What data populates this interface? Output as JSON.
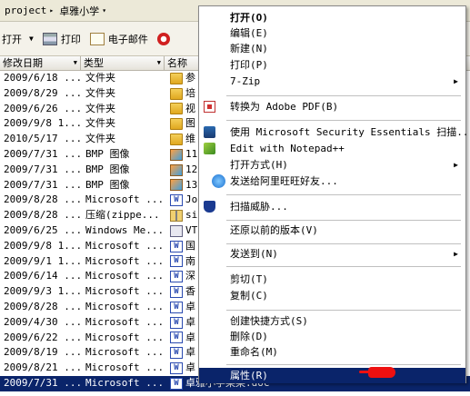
{
  "address": {
    "path": [
      "project",
      "卓雅小学"
    ]
  },
  "toolbar": {
    "open": "打开",
    "print": "打印",
    "email": "电子邮件"
  },
  "headers": {
    "date": "修改日期",
    "type": "类型",
    "name": "名称"
  },
  "rows": [
    {
      "date": "2009/6/18 ...",
      "type": "文件夹",
      "icon": "folder",
      "name": "参"
    },
    {
      "date": "2009/8/29 ...",
      "type": "文件夹",
      "icon": "folder",
      "name": "培"
    },
    {
      "date": "2009/6/26 ...",
      "type": "文件夹",
      "icon": "folder",
      "name": "视"
    },
    {
      "date": "2009/9/8 1...",
      "type": "文件夹",
      "icon": "folder",
      "name": "图"
    },
    {
      "date": "2010/5/17 ...",
      "type": "文件夹",
      "icon": "folder",
      "name": "维"
    },
    {
      "date": "2009/7/31 ...",
      "type": "BMP 图像",
      "icon": "bmp",
      "name": "11"
    },
    {
      "date": "2009/7/31 ...",
      "type": "BMP 图像",
      "icon": "bmp",
      "name": "12"
    },
    {
      "date": "2009/7/31 ...",
      "type": "BMP 图像",
      "icon": "bmp",
      "name": "13"
    },
    {
      "date": "2009/8/28 ...",
      "type": "Microsoft ...",
      "icon": "doc",
      "name": "Jo"
    },
    {
      "date": "2009/8/28 ...",
      "type": "压缩(zippe...",
      "icon": "zip",
      "name": "si"
    },
    {
      "date": "2009/6/25 ...",
      "type": "Windows Me...",
      "icon": "media",
      "name": "VT"
    },
    {
      "date": "2009/9/8 1...",
      "type": "Microsoft ...",
      "icon": "doc",
      "name": "国"
    },
    {
      "date": "2009/9/1 1...",
      "type": "Microsoft ...",
      "icon": "doc",
      "name": "南"
    },
    {
      "date": "2009/6/14 ...",
      "type": "Microsoft ...",
      "icon": "doc",
      "name": "深"
    },
    {
      "date": "2009/9/3 1...",
      "type": "Microsoft ...",
      "icon": "doc",
      "name": "香"
    },
    {
      "date": "2009/8/28 ...",
      "type": "Microsoft ...",
      "icon": "doc",
      "name": "卓"
    },
    {
      "date": "2009/4/30 ...",
      "type": "Microsoft ...",
      "icon": "doc",
      "name": "卓"
    },
    {
      "date": "2009/6/22 ...",
      "type": "Microsoft ...",
      "icon": "doc",
      "name": "卓"
    },
    {
      "date": "2009/8/19 ...",
      "type": "Microsoft ...",
      "icon": "doc",
      "name": "卓"
    },
    {
      "date": "2009/8/21 ...",
      "type": "Microsoft ...",
      "icon": "doc",
      "name": "卓"
    },
    {
      "date": "2009/7/31 ...",
      "type": "Microsoft ...",
      "icon": "doc",
      "name": "卓雅小学某某.doc",
      "selected": true
    }
  ],
  "menu": {
    "open": "打开(O)",
    "edit": "编辑(E)",
    "new": "新建(N)",
    "print": "打印(P)",
    "zip": "7-Zip",
    "pdf": "转换为 Adobe PDF(B)",
    "mse": "使用 Microsoft Security Essentials 扫描...",
    "notepad": "Edit with Notepad++",
    "openwith": "打开方式(H)",
    "wangwang": "发送给阿里旺旺好友...",
    "scan": "扫描威胁...",
    "restore": "还原以前的版本(V)",
    "sendto": "发送到(N)",
    "cut": "剪切(T)",
    "copy": "复制(C)",
    "shortcut": "创建快捷方式(S)",
    "delete": "删除(D)",
    "rename": "重命名(M)",
    "properties": "属性(R)"
  }
}
